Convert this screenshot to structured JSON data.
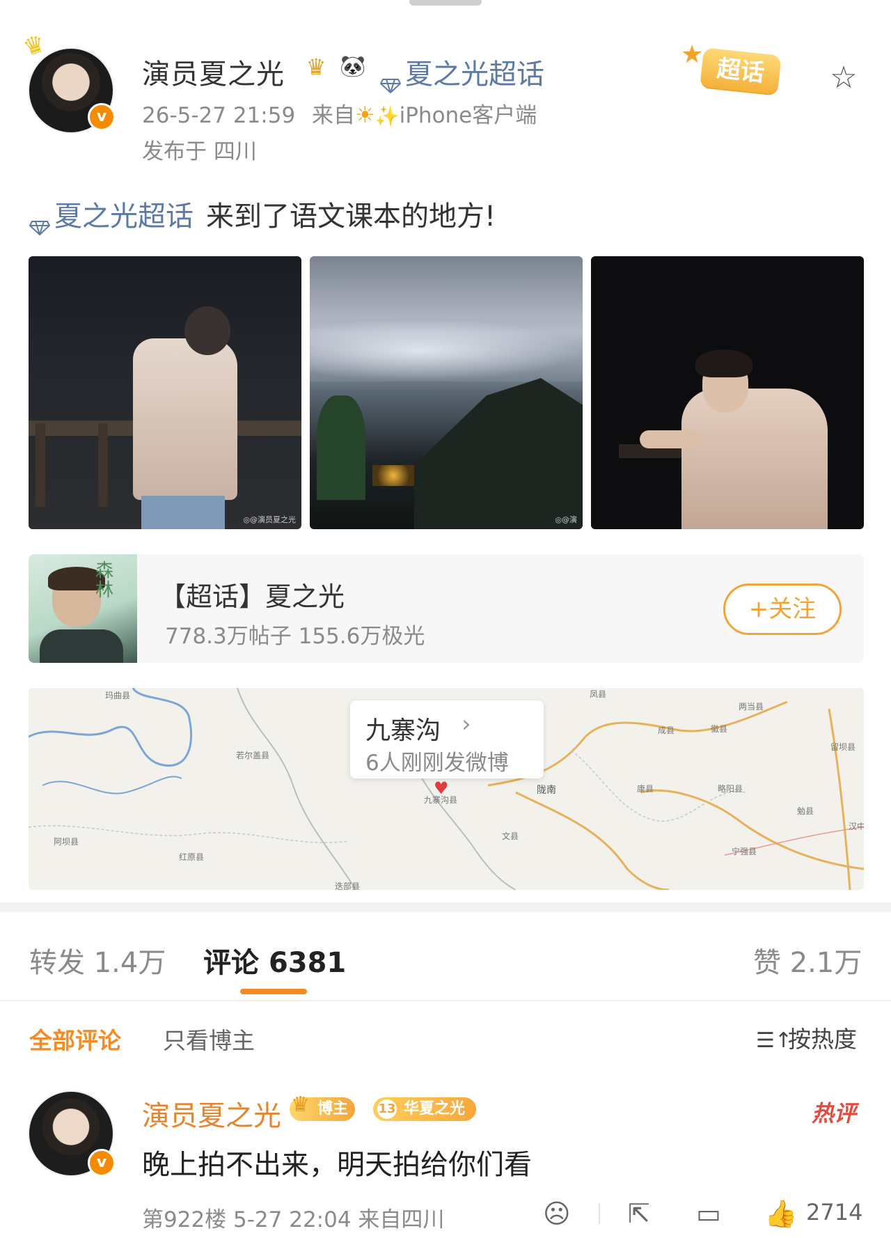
{
  "author": {
    "name": "演员夏之光",
    "supertopic_link": "夏之光超话",
    "time": "26-5-27 21:59",
    "source_prefix": "来自",
    "source_client": "iPhone客户端",
    "location": "发布于 四川"
  },
  "header_badge": {
    "label": "超话"
  },
  "post": {
    "tag": "夏之光超话",
    "text": "来到了语文课本的地方!"
  },
  "topic_card": {
    "title": "【超话】夏之光",
    "stats": "778.3万帖子 155.6万极光",
    "follow_label": "+关注"
  },
  "map": {
    "place": "九寨沟",
    "sub": "6人刚刚发微博",
    "labels": [
      "玛曲县",
      "若尔盖县",
      "九寨沟县",
      "陇南",
      "成县",
      "康县",
      "略阳县",
      "两当县",
      "徽县",
      "文县",
      "勉县",
      "宁强县",
      "阿坝县",
      "红原县",
      "汉中",
      "留坝县",
      "迭部县",
      "凤县"
    ]
  },
  "stats": {
    "repost": "转发 1.4万",
    "comment_label": "评论",
    "comment_count": "6381",
    "like": "赞 2.1万"
  },
  "filters": {
    "all": "全部评论",
    "owner_only": "只看博主",
    "sort": "按热度"
  },
  "comment": {
    "name": "演员夏之光",
    "owner_badge": "博主",
    "fan_level": "13",
    "fan_badge": "华夏之光",
    "hot_tag": "热评",
    "text": "晚上拍不出来，明天拍给你们看",
    "meta": "第922楼 5-27 22:04 来自四川",
    "likes": "2714"
  },
  "colors": {
    "accent": "#f58b24",
    "link": "#5b7ba6",
    "gray": "#8a8a8a",
    "hot": "#e64a3c"
  },
  "icons": [
    "crown-icon",
    "panda-icon",
    "diamond-icon",
    "sun-icon",
    "sparkle-icon",
    "star-icon",
    "chevron-right-icon",
    "map-pin-icon",
    "sort-icon",
    "emoji-icon",
    "share-icon",
    "comment-icon",
    "like-icon",
    "verified-icon"
  ]
}
